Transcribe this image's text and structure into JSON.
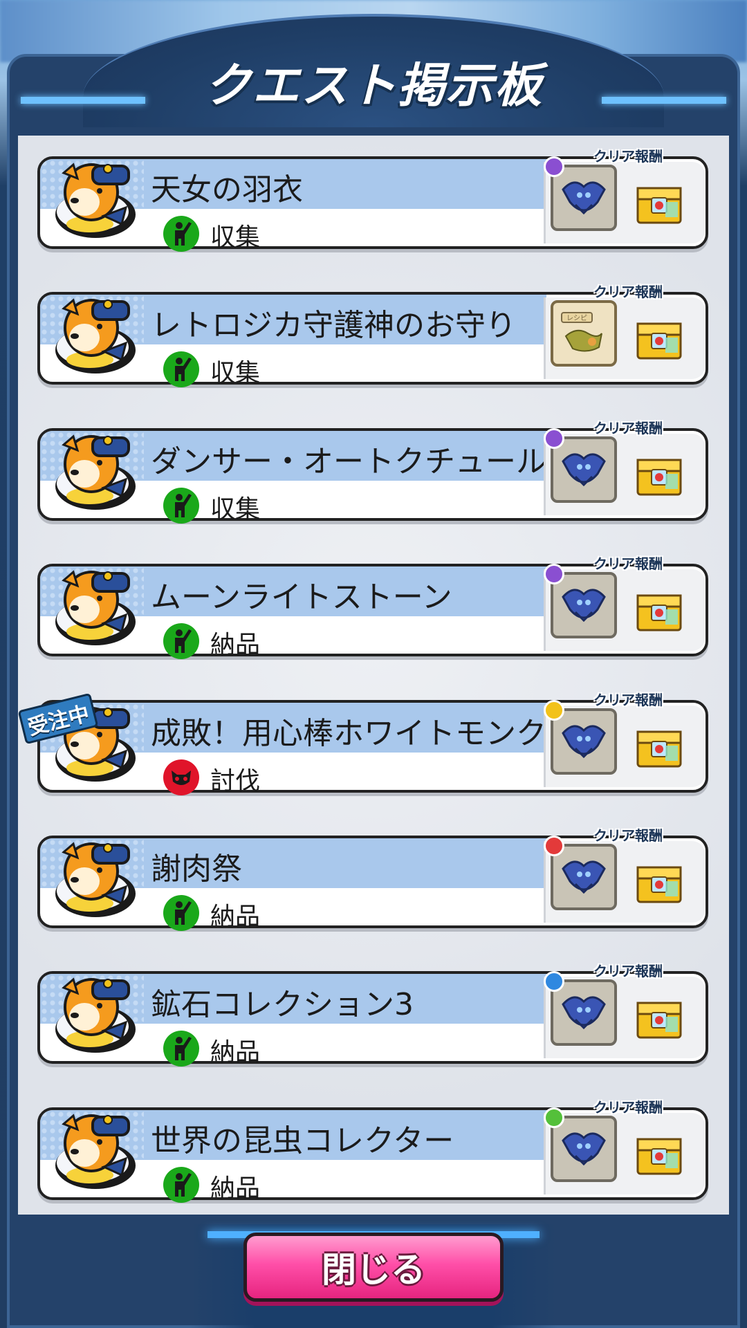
{
  "header": {
    "title": "クエスト掲示板"
  },
  "reward_caption": "クリア報酬",
  "accepted_badge": "受注中",
  "quests": [
    {
      "title": "天女の羽衣",
      "type": "収集",
      "type_icon": "person-raise-hand-icon",
      "type_color": "#1aa81a",
      "attribute_color": "#8a4fd1",
      "reward_icon": "monster-medal-icon",
      "accepted": false
    },
    {
      "title": "レトロジカ守護神のお守り",
      "type": "収集",
      "type_icon": "person-raise-hand-icon",
      "type_color": "#1aa81a",
      "attribute_color": "",
      "reward_icon": "recipe-icon",
      "reward_text": "レシピ",
      "accepted": false
    },
    {
      "title": "ダンサー・オートクチュール",
      "type": "収集",
      "type_icon": "person-raise-hand-icon",
      "type_color": "#1aa81a",
      "attribute_color": "#8a4fd1",
      "reward_icon": "monster-medal-icon",
      "accepted": false
    },
    {
      "title": "ムーンライトストーン",
      "type": "納品",
      "type_icon": "person-raise-hand-icon",
      "type_color": "#1aa81a",
      "attribute_color": "#8a4fd1",
      "reward_icon": "monster-medal-icon",
      "accepted": false
    },
    {
      "title": "成敗！用心棒ホワイトモンク",
      "type": "討伐",
      "type_icon": "monster-face-icon",
      "type_color": "#e0142a",
      "attribute_color": "#f2c21a",
      "reward_icon": "monster-medal-icon",
      "accepted": true
    },
    {
      "title": "謝肉祭",
      "type": "納品",
      "type_icon": "person-raise-hand-icon",
      "type_color": "#1aa81a",
      "attribute_color": "#e33a3a",
      "reward_icon": "monster-medal-icon",
      "accepted": false
    },
    {
      "title": "鉱石コレクション3",
      "type": "納品",
      "type_icon": "person-raise-hand-icon",
      "type_color": "#1aa81a",
      "attribute_color": "#2f88e0",
      "reward_icon": "monster-medal-icon",
      "accepted": false
    },
    {
      "title": "世界の昆虫コレクター",
      "type": "納品",
      "type_icon": "person-raise-hand-icon",
      "type_color": "#1aa81a",
      "attribute_color": "#54c03a",
      "reward_icon": "monster-medal-icon",
      "accepted": false
    }
  ],
  "footer": {
    "close_label": "閉じる"
  }
}
